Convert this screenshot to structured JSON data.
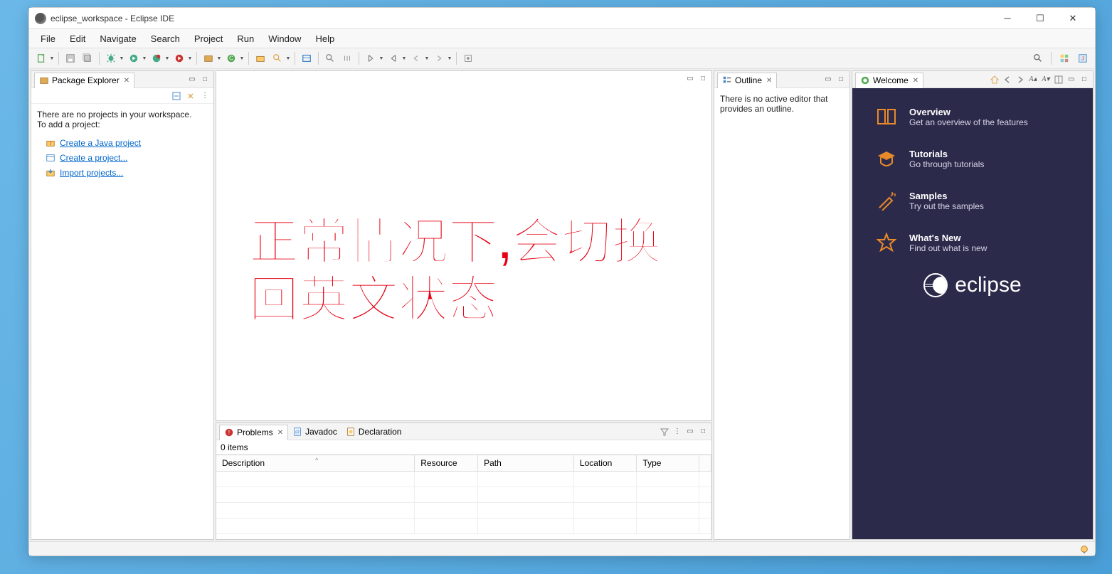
{
  "window": {
    "title": "eclipse_workspace - Eclipse IDE"
  },
  "menubar": [
    "File",
    "Edit",
    "Navigate",
    "Search",
    "Project",
    "Run",
    "Window",
    "Help"
  ],
  "package_explorer": {
    "tab": "Package Explorer",
    "msg1": "There are no projects in your workspace.",
    "msg2": "To add a project:",
    "links": {
      "java": "Create a Java project",
      "project": "Create a project...",
      "import": "Import projects..."
    }
  },
  "outline": {
    "tab": "Outline",
    "msg": "There is no active editor that provides an outline."
  },
  "problems": {
    "tab": "Problems",
    "tab_javadoc": "Javadoc",
    "tab_decl": "Declaration",
    "count": "0 items",
    "cols": {
      "desc": "Description",
      "res": "Resource",
      "path": "Path",
      "loc": "Location",
      "type": "Type"
    }
  },
  "welcome": {
    "tab": "Welcome",
    "items": {
      "overview": {
        "title": "Overview",
        "desc": "Get an overview of the features"
      },
      "tutorials": {
        "title": "Tutorials",
        "desc": "Go through tutorials"
      },
      "samples": {
        "title": "Samples",
        "desc": "Try out the samples"
      },
      "whatsnew": {
        "title": "What's New",
        "desc": "Find out what is new"
      }
    },
    "logo": "eclipse"
  },
  "overlay": {
    "line1": "正常情况下,会切换",
    "line2": "回英文状态"
  }
}
